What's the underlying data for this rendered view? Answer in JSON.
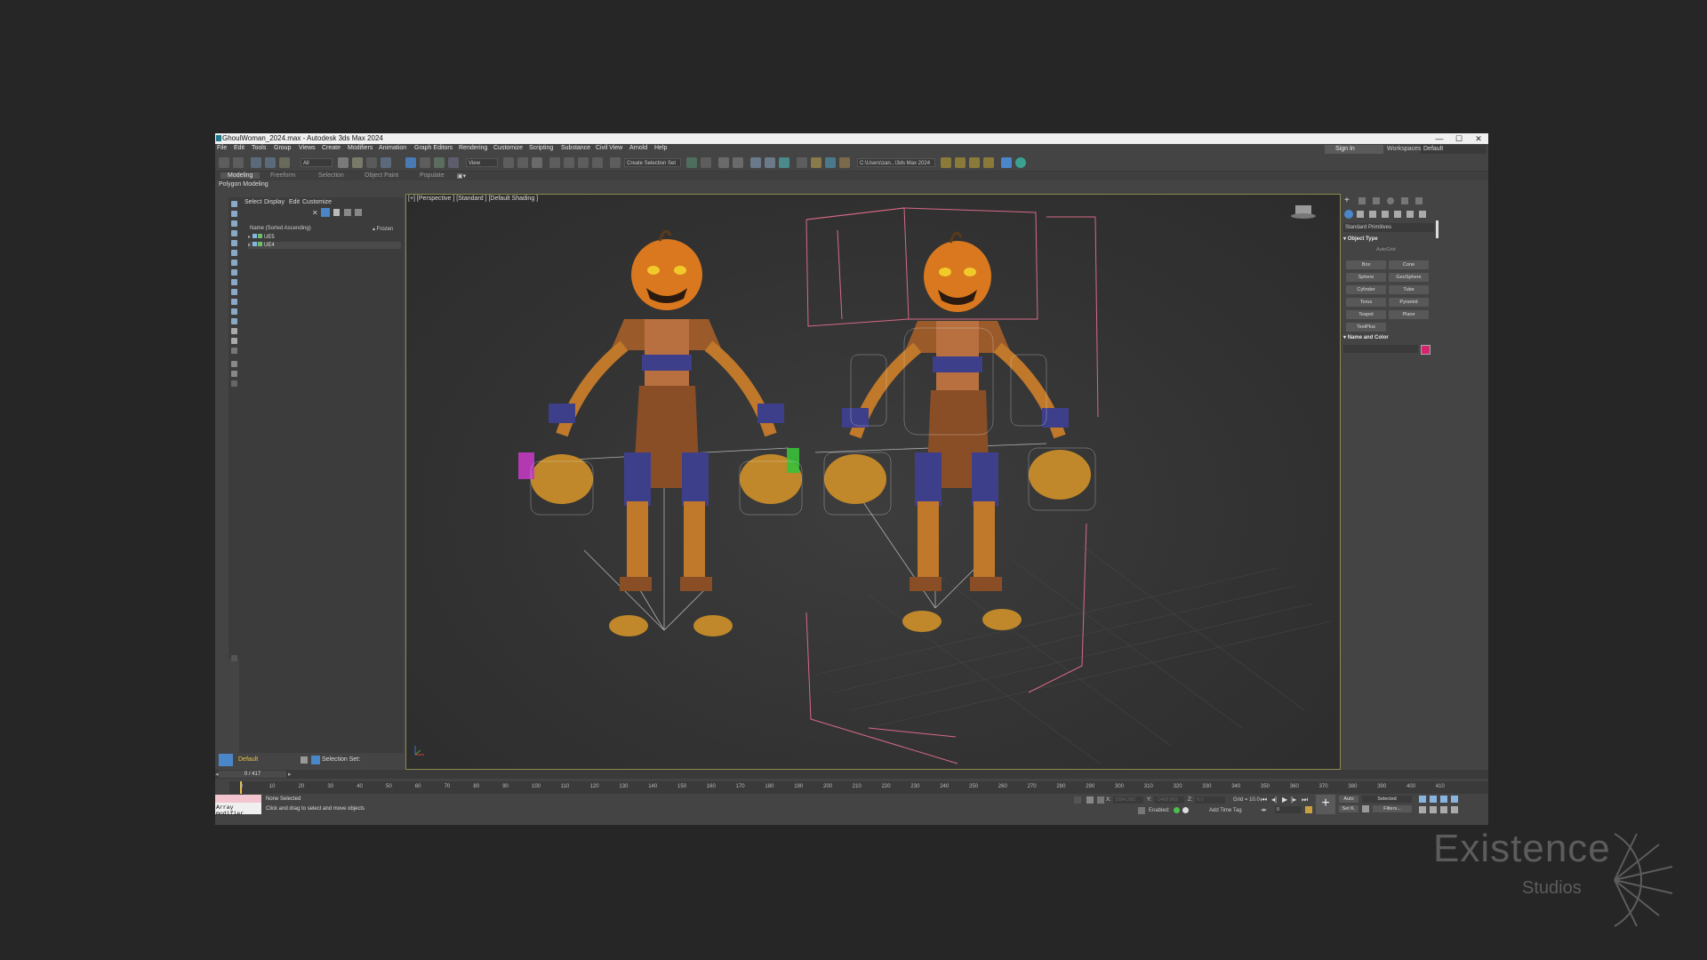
{
  "window": {
    "title": "GhoulWoman_2024.max - Autodesk 3ds Max 2024",
    "controls": {
      "minimize": "—",
      "maximize": "☐",
      "close": "✕"
    }
  },
  "menubar": {
    "items": [
      "File",
      "Edit",
      "Tools",
      "Group",
      "Views",
      "Create",
      "Modifiers",
      "Animation",
      "Graph Editors",
      "Rendering",
      "Customize",
      "Scripting",
      "Substance",
      "Civil View",
      "Arnold",
      "Help"
    ],
    "sign_in": "Sign In",
    "workspaces_label": "Workspaces:",
    "workspaces_value": "Default"
  },
  "toolbar": {
    "filter_select": "All",
    "view_select": "View",
    "selection_set": "Create Selection Set",
    "project_path": "C:\\Users\\zan...\\3ds Max 2024"
  },
  "ribbon": {
    "tabs": [
      "Modeling",
      "Freeform",
      "Selection",
      "Object Paint",
      "Populate"
    ],
    "active_tab": "Modeling",
    "sub_label": "Polygon Modeling"
  },
  "scene_explorer": {
    "menu": [
      "Select",
      "Display",
      "Edit",
      "Customize"
    ],
    "column_name": "Name (Sorted Ascending)",
    "column_frozen": "▴ Frozen",
    "rows": [
      "UE5",
      "UE4"
    ]
  },
  "layer_bar": {
    "layer": "Default",
    "selection_set": "Selection Set:"
  },
  "viewport": {
    "label": "[+] [Perspective ] [Standard ] [Default Shading ]"
  },
  "command_panel": {
    "category": "Standard Primitives",
    "object_type_title": "Object Type",
    "autogrid": "AutoGrid",
    "buttons": [
      "Box",
      "Cone",
      "Sphere",
      "GeoSphere",
      "Cylinder",
      "Tube",
      "Torus",
      "Pyramid",
      "Teapot",
      "Plane",
      "TextPlus"
    ],
    "name_color_title": "Name and Color",
    "color": "#d6246e"
  },
  "timeline": {
    "frame_counter": "0 / 417",
    "ticks": [
      "0",
      "10",
      "20",
      "30",
      "40",
      "50",
      "60",
      "70",
      "80",
      "90",
      "100",
      "110",
      "120",
      "130",
      "140",
      "150",
      "160",
      "170",
      "180",
      "190",
      "200",
      "210",
      "220",
      "230",
      "240",
      "250",
      "260",
      "270",
      "280",
      "290",
      "300",
      "310",
      "320",
      "330",
      "340",
      "350",
      "360",
      "370",
      "380",
      "390",
      "400",
      "410"
    ]
  },
  "status": {
    "maxscript": "Array modifier",
    "line1": "None Selected",
    "line2": "Click and drag to select and move objects",
    "x_label": "X:",
    "x_value": "1084.392",
    "y_label": "Y:",
    "y_value": "-1469.863",
    "z_label": "Z:",
    "z_value": "0.0",
    "grid": "Grid = 10.0",
    "enabled": "Enabled:",
    "add_time_tag": "Add Time Tag",
    "auto": "Auto",
    "selected": "Selected",
    "set_k": "Set K.",
    "filters": "Filters...",
    "frame": "0"
  },
  "watermark": {
    "title": "Existence",
    "subtitle": "Studios"
  }
}
